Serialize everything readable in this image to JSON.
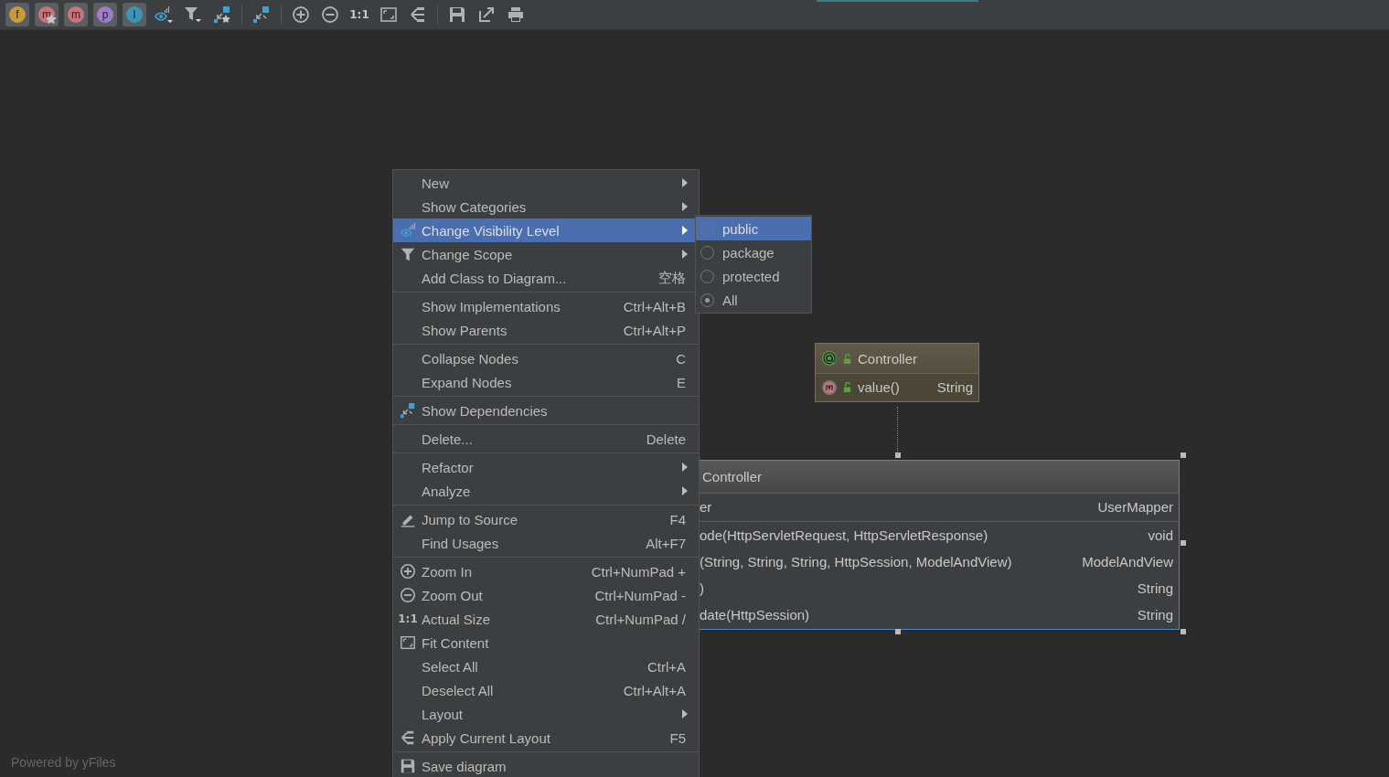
{
  "toolbar": [
    {
      "kind": "toggle",
      "letter": "f",
      "color": "#c99a3c",
      "pressed": true,
      "star": false
    },
    {
      "kind": "toggle",
      "letter": "m",
      "color": "#c9737d",
      "pressed": true,
      "star": true
    },
    {
      "kind": "toggle",
      "letter": "m",
      "color": "#c9737d",
      "pressed": true,
      "star": false
    },
    {
      "kind": "toggle",
      "letter": "p",
      "color": "#9b7fc9",
      "pressed": true,
      "star": false
    },
    {
      "kind": "toggle",
      "letter": "I",
      "color": "#3a95b8",
      "pressed": true,
      "star": false
    },
    {
      "kind": "icon"
    },
    {
      "kind": "icon"
    },
    {
      "kind": "icon"
    },
    {
      "kind": "separator"
    },
    {
      "kind": "icon"
    },
    {
      "kind": "separator"
    },
    {
      "kind": "icon"
    },
    {
      "kind": "icon"
    },
    {
      "kind": "text",
      "label": "1:1"
    },
    {
      "kind": "icon"
    },
    {
      "kind": "icon"
    },
    {
      "kind": "separator"
    },
    {
      "kind": "icon"
    },
    {
      "kind": "icon"
    },
    {
      "kind": "icon"
    }
  ],
  "diagram": {
    "nodes": [
      {
        "kind": "annotation",
        "title": "Controller",
        "selected": false,
        "methods": [
          {
            "name": "value()",
            "type": "String"
          }
        ]
      },
      {
        "kind": "class",
        "title": "Controller",
        "selected": true,
        "fields": [
          {
            "name": "er",
            "type": "UserMapper"
          }
        ],
        "methods": [
          {
            "name": "ode(HttpServletRequest, HttpServletResponse)",
            "type": "void"
          },
          {
            "name": "(String, String, String, HttpSession, ModelAndView)",
            "type": "ModelAndView"
          },
          {
            "name": ")",
            "type": "String"
          },
          {
            "name": "date(HttpSession)",
            "type": "String"
          }
        ]
      }
    ],
    "footer": "Powered by yFiles"
  },
  "context_menu": {
    "items": [
      {
        "kind": "item",
        "label": "New",
        "submenu": true,
        "selected": false
      },
      {
        "kind": "item",
        "label": "Show Categories",
        "submenu": true,
        "selected": false
      },
      {
        "kind": "item",
        "label": "Change Visibility Level",
        "submenu": true,
        "selected": true
      },
      {
        "kind": "item",
        "label": "Change Scope",
        "submenu": true,
        "selected": false
      },
      {
        "kind": "item",
        "label": "Add Class to Diagram...",
        "shortcut": "空格",
        "submenu": false,
        "selected": false
      },
      {
        "kind": "separator"
      },
      {
        "kind": "item",
        "label": "Show Implementations",
        "shortcut": "Ctrl+Alt+B",
        "submenu": false,
        "selected": false
      },
      {
        "kind": "item",
        "label": "Show Parents",
        "shortcut": "Ctrl+Alt+P",
        "submenu": false,
        "selected": false
      },
      {
        "kind": "separator"
      },
      {
        "kind": "item",
        "label": "Collapse Nodes",
        "shortcut": "C",
        "submenu": false,
        "selected": false
      },
      {
        "kind": "item",
        "label": "Expand Nodes",
        "shortcut": "E",
        "submenu": false,
        "selected": false
      },
      {
        "kind": "separator"
      },
      {
        "kind": "item",
        "label": "Show Dependencies",
        "submenu": false,
        "selected": false
      },
      {
        "kind": "separator"
      },
      {
        "kind": "item",
        "label": "Delete...",
        "shortcut": "Delete",
        "submenu": false,
        "selected": false
      },
      {
        "kind": "separator"
      },
      {
        "kind": "item",
        "label": "Refactor",
        "submenu": true,
        "selected": false
      },
      {
        "kind": "item",
        "label": "Analyze",
        "submenu": true,
        "selected": false
      },
      {
        "kind": "separator"
      },
      {
        "kind": "item",
        "label": "Jump to Source",
        "shortcut": "F4",
        "submenu": false,
        "selected": false
      },
      {
        "kind": "item",
        "label": "Find Usages",
        "shortcut": "Alt+F7",
        "submenu": false,
        "selected": false
      },
      {
        "kind": "separator"
      },
      {
        "kind": "item",
        "label": "Zoom In",
        "shortcut": "Ctrl+NumPad +",
        "submenu": false,
        "selected": false
      },
      {
        "kind": "item",
        "label": "Zoom Out",
        "shortcut": "Ctrl+NumPad -",
        "submenu": false,
        "selected": false
      },
      {
        "kind": "item",
        "label": "Actual Size",
        "icon_text": "1:1",
        "shortcut": "Ctrl+NumPad /",
        "submenu": false,
        "selected": false
      },
      {
        "kind": "item",
        "label": "Fit Content",
        "submenu": false,
        "selected": false
      },
      {
        "kind": "item",
        "label": "Select All",
        "shortcut": "Ctrl+A",
        "submenu": false,
        "selected": false
      },
      {
        "kind": "item",
        "label": "Deselect All",
        "shortcut": "Ctrl+Alt+A",
        "submenu": false,
        "selected": false
      },
      {
        "kind": "item",
        "label": "Layout",
        "submenu": true,
        "selected": false
      },
      {
        "kind": "item",
        "label": "Apply Current Layout",
        "shortcut": "F5",
        "submenu": false,
        "selected": false
      },
      {
        "kind": "separator"
      },
      {
        "kind": "item",
        "label": "Save diagram",
        "submenu": false,
        "selected": false
      }
    ]
  },
  "submenu": {
    "items": [
      {
        "label": "public",
        "selected": true,
        "checked": false
      },
      {
        "label": "package",
        "selected": false,
        "checked": false
      },
      {
        "label": "protected",
        "selected": false,
        "checked": false
      },
      {
        "label": "All",
        "selected": false,
        "checked": true
      }
    ]
  }
}
